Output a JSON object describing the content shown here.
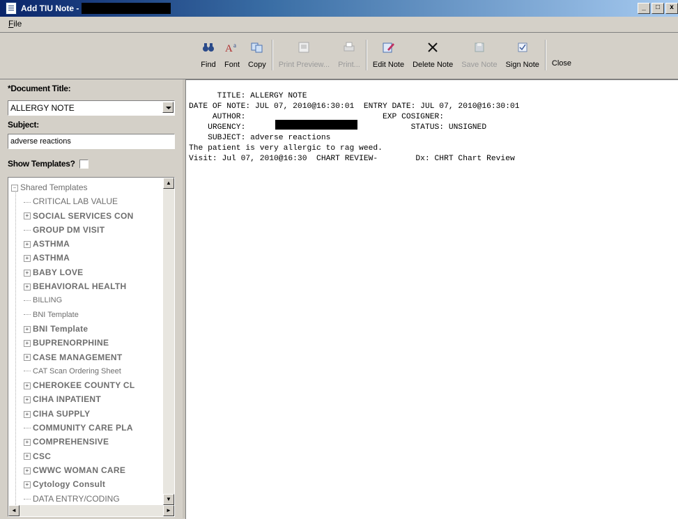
{
  "window": {
    "title": "Add TIU Note -",
    "buttons": {
      "minimize": "_",
      "maximize": "□",
      "close": "x"
    }
  },
  "menubar": {
    "items": [
      "File"
    ]
  },
  "toolbar": {
    "buttons": [
      {
        "label": "Find",
        "icon": "binoculars-icon",
        "enabled": true
      },
      {
        "label": "Font",
        "icon": "font-icon",
        "enabled": true
      },
      {
        "label": "Copy",
        "icon": "copy-icon",
        "enabled": true
      },
      {
        "label": "Print Preview...",
        "icon": "print-preview-icon",
        "enabled": false
      },
      {
        "label": "Print...",
        "icon": "printer-icon",
        "enabled": false
      },
      {
        "label": "Edit Note",
        "icon": "edit-note-icon",
        "enabled": true
      },
      {
        "label": "Delete Note",
        "icon": "delete-x-icon",
        "enabled": true
      },
      {
        "label": "Save Note",
        "icon": "save-icon",
        "enabled": false
      },
      {
        "label": "Sign Note",
        "icon": "sign-checkbox-icon",
        "enabled": true
      },
      {
        "label": "Close",
        "icon": "",
        "enabled": true
      }
    ]
  },
  "left": {
    "document_title_label": "*Document Title:",
    "document_title_value": "ALLERGY NOTE",
    "subject_label": "Subject:",
    "subject_value": "adverse reactions",
    "show_templates_label": "Show Templates?",
    "templates": [
      {
        "text": "Shared Templates",
        "level": 0,
        "expandable": true
      },
      {
        "text": "CRITICAL LAB VALUE",
        "level": 1,
        "expandable": false,
        "style": "plain"
      },
      {
        "text": "SOCIAL SERVICES CON",
        "level": 1,
        "expandable": true,
        "style": "caps"
      },
      {
        "text": "GROUP DM VISIT",
        "level": 1,
        "expandable": false,
        "style": "caps"
      },
      {
        "text": "ASTHMA",
        "level": 1,
        "expandable": true,
        "style": "caps"
      },
      {
        "text": "ASTHMA",
        "level": 1,
        "expandable": true,
        "style": "caps"
      },
      {
        "text": "BABY LOVE",
        "level": 1,
        "expandable": true,
        "style": "caps"
      },
      {
        "text": "BEHAVIORAL HEALTH",
        "level": 1,
        "expandable": true,
        "style": "caps"
      },
      {
        "text": "BILLING",
        "level": 1,
        "expandable": false,
        "style": "small"
      },
      {
        "text": "BNI Template",
        "level": 1,
        "expandable": false,
        "style": "small"
      },
      {
        "text": "BNI Template",
        "level": 1,
        "expandable": true,
        "style": "caps"
      },
      {
        "text": "BUPRENORPHINE",
        "level": 1,
        "expandable": true,
        "style": "caps"
      },
      {
        "text": "CASE MANAGEMENT",
        "level": 1,
        "expandable": true,
        "style": "caps"
      },
      {
        "text": "CAT Scan Ordering Sheet",
        "level": 1,
        "expandable": false,
        "style": "small"
      },
      {
        "text": "CHEROKEE COUNTY CL",
        "level": 1,
        "expandable": true,
        "style": "caps"
      },
      {
        "text": "CIHA INPATIENT",
        "level": 1,
        "expandable": true,
        "style": "caps"
      },
      {
        "text": "CIHA SUPPLY",
        "level": 1,
        "expandable": true,
        "style": "caps"
      },
      {
        "text": "COMMUNITY CARE PLA",
        "level": 1,
        "expandable": false,
        "style": "caps"
      },
      {
        "text": "COMPREHENSIVE",
        "level": 1,
        "expandable": true,
        "style": "caps"
      },
      {
        "text": "CSC",
        "level": 1,
        "expandable": true,
        "style": "caps"
      },
      {
        "text": "CWWC WOMAN CARE",
        "level": 1,
        "expandable": true,
        "style": "caps"
      },
      {
        "text": "Cytology Consult",
        "level": 1,
        "expandable": true,
        "style": "caps"
      },
      {
        "text": "DATA ENTRY/CODING",
        "level": 1,
        "expandable": false,
        "style": "plain"
      }
    ]
  },
  "note": {
    "line1": "      TITLE: ALLERGY NOTE",
    "line2": "DATE OF NOTE: JUL 07, 2010@16:30:01  ENTRY DATE: JUL 07, 2010@16:30:01",
    "line3": "     AUTHOR:                             EXP COSIGNER:",
    "line4": "    URGENCY:                                   STATUS: UNSIGNED",
    "line5": "    SUBJECT: adverse reactions",
    "line6": "",
    "line7": "The patient is very allergic to rag weed.",
    "line8": "",
    "line9": "Visit: Jul 07, 2010@16:30  CHART REVIEW-        Dx: CHRT Chart Review"
  }
}
